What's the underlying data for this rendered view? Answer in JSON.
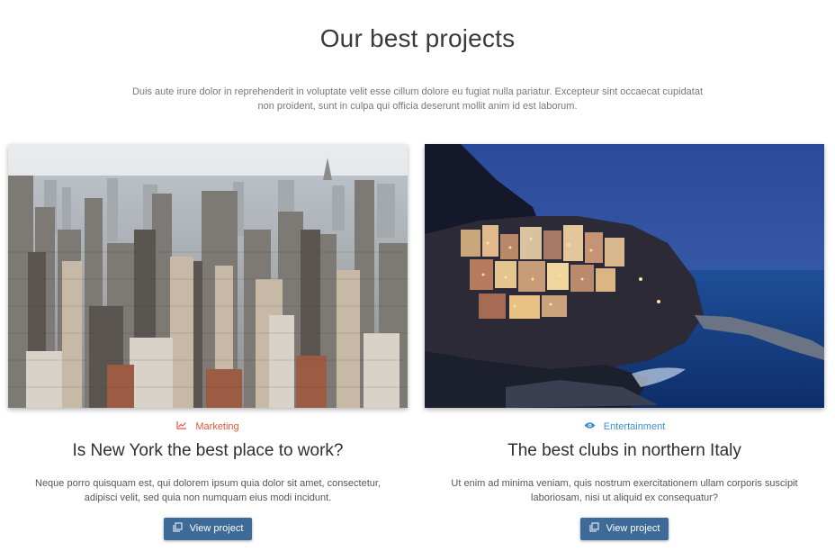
{
  "section": {
    "title": "Our best projects",
    "intro": "Duis aute irure dolor in reprehenderit in voluptate velit esse cillum dolore eu fugiat nulla pariatur. Excepteur sint occaecat cupidatat non proident, sunt in culpa qui officia deserunt mollit anim id est laborum."
  },
  "projects": [
    {
      "category": "Marketing",
      "category_icon": "chart-line-icon",
      "category_color": "#e5533d",
      "title": "Is New York the best place to work?",
      "description": "Neque porro quisquam est, qui dolorem ipsum quia dolor sit amet, consectetur, adipisci velit, sed quia non numquam eius modi incidunt.",
      "button_label": "View project",
      "image": "new-york-skyline-photo"
    },
    {
      "category": "Entertainment",
      "category_icon": "eye-icon",
      "category_color": "#3b8fd2",
      "title": "The best clubs in northern Italy",
      "description": "Ut enim ad minima veniam, quis nostrum exercitationem ullam corporis suscipit laboriosam, nisi ut aliquid ex consequatur?",
      "button_label": "View project",
      "image": "italian-coast-village-photo"
    }
  ],
  "colors": {
    "button": "#3d6a96",
    "marketing": "#e5533d",
    "entertainment": "#3b8fd2"
  }
}
